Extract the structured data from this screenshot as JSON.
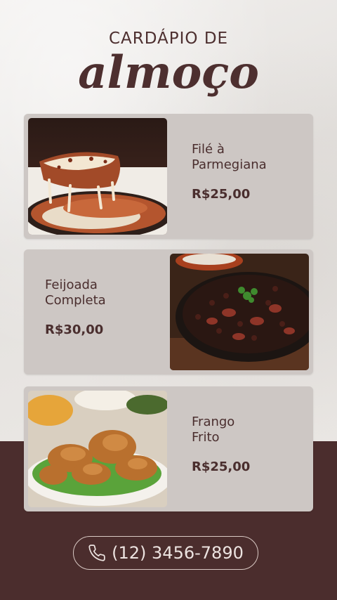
{
  "header": {
    "subtitle": "CARDÁPIO DE",
    "title": "almoço"
  },
  "menu": [
    {
      "name_line1": "Filé à",
      "name_line2": "Parmegiana",
      "price": "R$25,00",
      "image": "parmegiana-photo"
    },
    {
      "name_line1": "Feijoada",
      "name_line2": "Completa",
      "price": "R$30,00",
      "image": "feijoada-photo"
    },
    {
      "name_line1": "Frango",
      "name_line2": "Frito",
      "price": "R$25,00",
      "image": "frango-frito-photo"
    }
  ],
  "contact": {
    "phone": "(12) 3456-7890",
    "icon": "phone-icon"
  },
  "colors": {
    "brand": "#4b2d2d",
    "card": "#cdc7c4",
    "background": "#e9e6e3"
  }
}
